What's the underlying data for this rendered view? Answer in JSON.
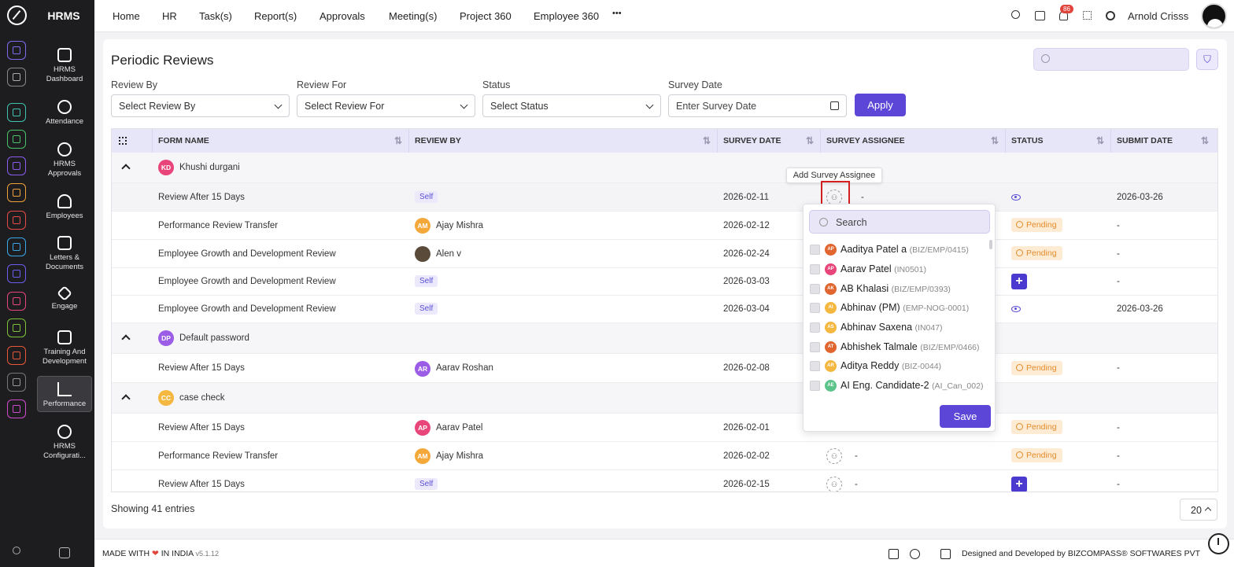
{
  "brand": "HRMS",
  "nav": [
    {
      "label": "HRMS Dashboard"
    },
    {
      "label": "Attendance"
    },
    {
      "label": "HRMS Approvals"
    },
    {
      "label": "Employees"
    },
    {
      "label": "Letters & Documents"
    },
    {
      "label": "Engage"
    },
    {
      "label": "Training And Development"
    },
    {
      "label": "Performance"
    },
    {
      "label": "HRMS Configurati..."
    }
  ],
  "topnav": [
    "Home",
    "HR",
    "Task(s)",
    "Report(s)",
    "Approvals",
    "Meeting(s)",
    "Project 360",
    "Employee 360"
  ],
  "topbar": {
    "more": "•••",
    "notif_count": "86",
    "user": "Arnold Crisss"
  },
  "page": {
    "title": "Periodic Reviews"
  },
  "filters": {
    "review_by_label": "Review By",
    "review_by_value": "Select Review By",
    "review_for_label": "Review For",
    "review_for_value": "Select Review For",
    "status_label": "Status",
    "status_value": "Select Status",
    "survey_date_label": "Survey Date",
    "survey_date_placeholder": "Enter Survey Date",
    "apply": "Apply"
  },
  "table": {
    "headers": [
      "FORM NAME",
      "REVIEW BY",
      "SURVEY DATE",
      "SURVEY ASSIGNEE",
      "STATUS",
      "SUBMIT DATE"
    ],
    "groups": [
      {
        "initials": "KD",
        "name": "Khushi durgani",
        "color": "#e8457a"
      },
      {
        "initials": "DP",
        "name": "Default password",
        "color": "#9b5de5"
      },
      {
        "initials": "CC",
        "name": "case check",
        "color": "#f4b740"
      }
    ],
    "rows": [
      {
        "form": "Review After 15 Days",
        "review_by": "Self",
        "survey_date": "2026-02-11",
        "assignee": "-",
        "status": "view",
        "submit": "2026-03-26"
      },
      {
        "form": "Performance Review Transfer",
        "review_by": "Ajay Mishra",
        "reviewer_initials": "AM",
        "survey_date": "2026-02-12",
        "status": "Pending",
        "submit": "-"
      },
      {
        "form": "Employee Growth and Development Review",
        "review_by": "Alen v",
        "survey_date": "2026-02-24",
        "status": "Pending",
        "submit": "-"
      },
      {
        "form": "Employee Growth and Development Review",
        "review_by": "Self",
        "survey_date": "2026-03-03",
        "status": "add",
        "submit": "-"
      },
      {
        "form": "Employee Growth and Development Review",
        "review_by": "Self",
        "survey_date": "2026-03-04",
        "status": "view",
        "submit": "2026-03-26"
      },
      {
        "form": "Review After 15 Days",
        "review_by": "Aarav Roshan",
        "reviewer_initials": "AR",
        "survey_date": "2026-02-08",
        "status": "Pending",
        "submit": "-"
      },
      {
        "form": "Review After 15 Days",
        "review_by": "Aarav Patel",
        "reviewer_initials": "AP",
        "survey_date": "2026-02-01",
        "status": "Pending",
        "submit": "-"
      },
      {
        "form": "Performance Review Transfer",
        "review_by": "Ajay Mishra",
        "reviewer_initials": "AM",
        "survey_date": "2026-02-02",
        "assignee": "-",
        "status": "Pending",
        "submit": "-"
      },
      {
        "form": "Review After 15 Days",
        "review_by": "Self",
        "survey_date": "2026-02-15",
        "assignee": "-",
        "status": "add",
        "submit": "-"
      }
    ]
  },
  "tooltip": "Add Survey Assignee",
  "assignee_dropdown": {
    "search_placeholder": "Search",
    "save": "Save",
    "items": [
      {
        "name": "Aaditya Patel a",
        "code": "(BIZ/EMP/0415)",
        "initials": "AP",
        "color": "#e0652f"
      },
      {
        "name": "Aarav Patel",
        "code": "(IN0501)",
        "initials": "AP",
        "color": "#e8457a"
      },
      {
        "name": "AB Khalasi",
        "code": "(BIZ/EMP/0393)",
        "initials": "AK",
        "color": "#e0652f"
      },
      {
        "name": "Abhinav (PM)",
        "code": "(EMP-NOG-0001)",
        "initials": "AI",
        "color": "#f4b740"
      },
      {
        "name": "Abhinav Saxena",
        "code": "(IN047)",
        "initials": "AS",
        "color": "#f4b740"
      },
      {
        "name": "Abhishek Talmale",
        "code": "(BIZ/EMP/0466)",
        "initials": "AT",
        "color": "#e0652f"
      },
      {
        "name": "Aditya Reddy",
        "code": "(BIZ-0044)",
        "initials": "AR",
        "color": "#f4b740"
      },
      {
        "name": "AI Eng. Candidate-2",
        "code": "(AI_Can_002)",
        "initials": "AE",
        "color": "#5cc48a"
      }
    ]
  },
  "footer": {
    "made_prefix": "MADE WITH",
    "heart": "❤",
    "made_suffix": "IN INDIA",
    "version": "v5.1.12",
    "designed": "Designed and Developed by  BIZCOMPASS® SOFTWARES PVT"
  },
  "pagination": {
    "showing": "Showing 41 entries",
    "page_size": "20"
  },
  "colors": {
    "accent": "#5b46d8",
    "pending_bg": "#fdebd3",
    "pending_fg": "#e38b2b",
    "header_bg": "#e7e5f8"
  }
}
